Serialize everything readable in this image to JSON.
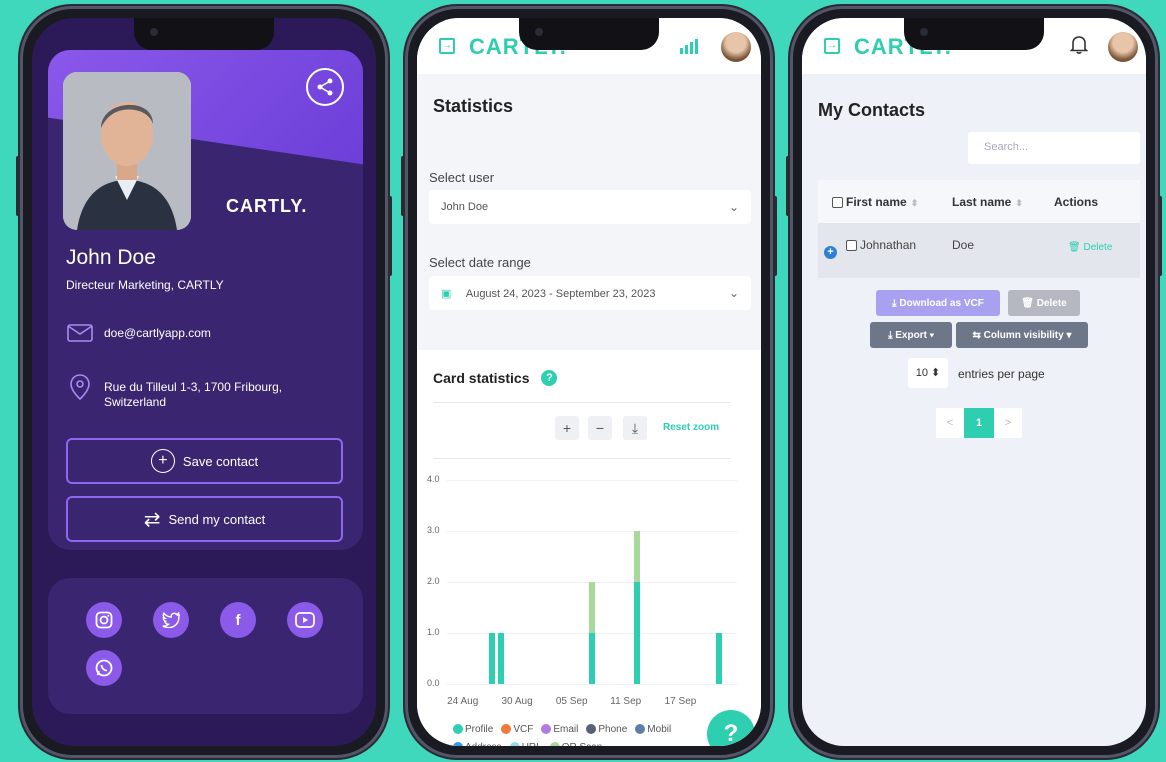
{
  "phone1": {
    "brand": "CARTLY.",
    "name": "John Doe",
    "title": "Directeur Marketing, CARTLY",
    "email": "doe@cartlyapp.com",
    "address_line1": "Rue du Tilleul 1-3, 1700 Fribourg,",
    "address_line2": "Switzerland",
    "save_contact": "Save contact",
    "send_contact": "Send my contact",
    "socials": [
      "instagram-icon",
      "twitter-icon",
      "facebook-icon",
      "youtube-icon",
      "whatsapp-icon"
    ],
    "colors": {
      "accent": "#8b5ae8",
      "background": "#2b1a57"
    }
  },
  "phone2": {
    "brand": "CARTLY.",
    "section_title": "Statistics",
    "select_user_label": "Select user",
    "select_user_value": "John Doe",
    "date_range_label": "Select date range",
    "date_range_value": "August 24, 2023 - September 23, 2023",
    "card_stats_title": "Card statistics",
    "help": "?",
    "reset_zoom": "Reset zoom",
    "zoom_in": "+",
    "zoom_out": "−",
    "download": "⤓",
    "fab": "?"
  },
  "chart_data": {
    "type": "bar",
    "stacked": true,
    "y_ticks": [
      "4.0",
      "3.0",
      "2.0",
      "1.0",
      "0.0"
    ],
    "x_ticks": [
      "24 Aug",
      "30 Aug",
      "05 Sep",
      "11 Sep",
      "17 Sep"
    ],
    "ylim": [
      0,
      4
    ],
    "bars": [
      {
        "date": "2023-08-27",
        "Profile": 1,
        "QR Scan": 0
      },
      {
        "date": "2023-08-28",
        "Profile": 1,
        "QR Scan": 0
      },
      {
        "date": "2023-09-07",
        "Profile": 1,
        "QR Scan": 1
      },
      {
        "date": "2023-09-12",
        "Profile": 2,
        "QR Scan": 1
      },
      {
        "date": "2023-09-21",
        "Profile": 1,
        "QR Scan": 0
      }
    ],
    "legend": [
      {
        "name": "Profile",
        "color": "#2ecfb0"
      },
      {
        "name": "VCF",
        "color": "#f07a3a"
      },
      {
        "name": "Email",
        "color": "#b07ae0"
      },
      {
        "name": "Phone",
        "color": "#5a5f7a"
      },
      {
        "name": "Mobil",
        "color": "#5b7fa6"
      },
      {
        "name": "Address",
        "color": "#2f9be0"
      },
      {
        "name": "URL",
        "color": "#9ad8f0"
      },
      {
        "name": "QR Scan",
        "color": "#a8d89a"
      }
    ]
  },
  "phone3": {
    "brand": "CARTLY.",
    "section_title": "My Contacts",
    "search_placeholder": "Search...",
    "col_first": "First name",
    "col_last": "Last name",
    "col_actions": "Actions",
    "rows": [
      {
        "first": "Johnathan",
        "last": "Doe",
        "action": "Delete"
      }
    ],
    "download_vcf": "⤓ Download as VCF",
    "delete_btn": "🗑 Delete",
    "export_btn": "⤓ Export ▾",
    "colvis_btn": "⇆ Column visibility ▾",
    "per_page_value": "10 ⬍",
    "per_page_label": "entries per page",
    "page_prev": "<",
    "page_current": "1",
    "page_next": ">"
  }
}
